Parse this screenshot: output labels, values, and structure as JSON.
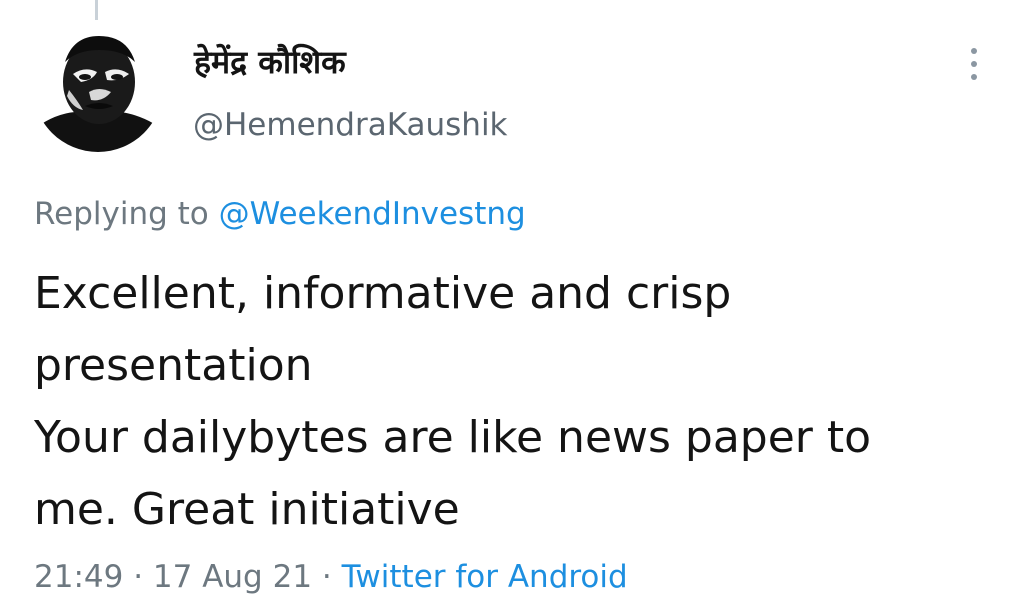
{
  "tweet": {
    "author": {
      "display_name": "हेमेंद्र कौशिक",
      "handle": "@HemendraKaushik"
    },
    "reply": {
      "prefix": "Replying to ",
      "mention": "@WeekendInvestng"
    },
    "text_lines": [
      "Excellent, informative and crisp",
      "presentation",
      "Your dailybytes are like news paper to",
      "me. Great initiative"
    ],
    "time": "21:49",
    "date": "17 Aug 21",
    "separator": " · ",
    "source": "Twitter for Android"
  },
  "icons": {
    "more": "more-vertical-icon",
    "avatar": "avatar-image"
  },
  "colors": {
    "link": "#1d8fe0",
    "secondary_text": "#6d7880",
    "primary_text": "#141414",
    "thread_line": "#c9d1d8"
  }
}
